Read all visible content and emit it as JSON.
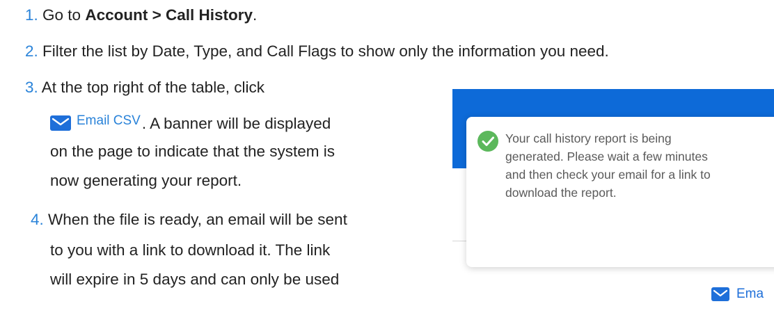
{
  "steps": [
    {
      "num": "1.",
      "pre": "Go to ",
      "bold": "Account > Call History",
      "post": "."
    },
    {
      "num": "2.",
      "text": "Filter the list by Date, Type, and Call Flags to show only the information you need."
    },
    {
      "num": "3.",
      "line1": "At the top right of the table, click",
      "button_label": "Email CSV",
      "line2_after": ". A banner will be displayed",
      "line3": "on the page to indicate that the system is",
      "line4": "now generating your report."
    },
    {
      "num": "4.",
      "line1": "When the file is ready, an email will be sent",
      "line2": "to you with a link to download it. The link",
      "line3": "will expire in 5 days and can only be used"
    }
  ],
  "screenshot": {
    "toast_message": "Your call history report is being\ngenerated. Please wait a few minutes\nand then check your email for a link to\ndownload the report.",
    "email_button_label": "Ema",
    "colors": {
      "header": "#0d6ad8",
      "check": "#5cb85c",
      "accent": "#2a83d9"
    },
    "icons": [
      "check-circle-icon",
      "mail-icon"
    ]
  }
}
